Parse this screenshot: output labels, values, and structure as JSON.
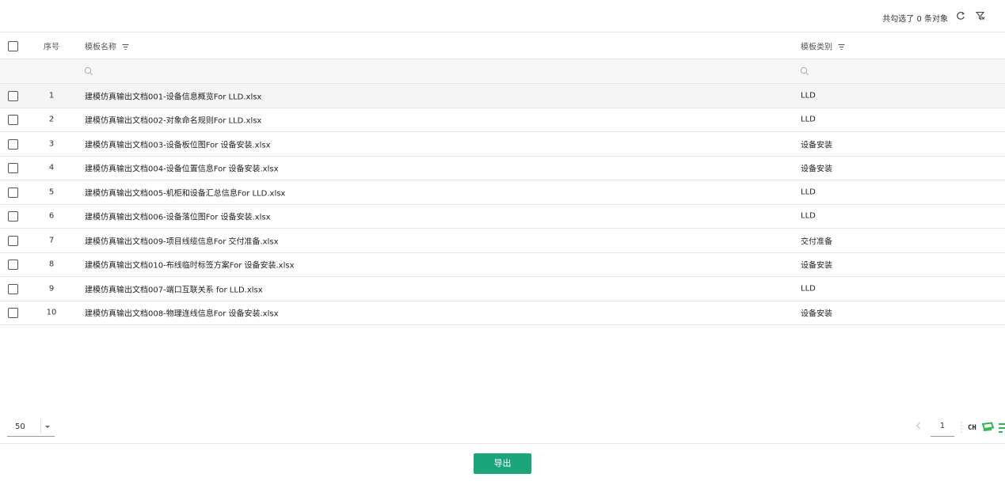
{
  "toolbar": {
    "selection_text": "共勾选了 0 条对象",
    "refresh_icon": "refresh-icon",
    "clear_filter_icon": "filter-clear-icon"
  },
  "table": {
    "columns": {
      "index": "序号",
      "name": "模板名称",
      "type": "模板类别"
    },
    "rows": [
      {
        "index": "1",
        "name": "建模仿真输出文档001-设备信息概览For LLD.xlsx",
        "type": "LLD"
      },
      {
        "index": "2",
        "name": "建模仿真输出文档002-对象命名规则For LLD.xlsx",
        "type": "LLD"
      },
      {
        "index": "3",
        "name": "建模仿真输出文档003-设备板位图For 设备安装.xlsx",
        "type": "设备安装"
      },
      {
        "index": "4",
        "name": "建模仿真输出文档004-设备位置信息For 设备安装.xlsx",
        "type": "设备安装"
      },
      {
        "index": "5",
        "name": "建模仿真输出文档005-机柜和设备汇总信息For LLD.xlsx",
        "type": "LLD"
      },
      {
        "index": "6",
        "name": "建模仿真输出文档006-设备落位图For 设备安装.xlsx",
        "type": "LLD"
      },
      {
        "index": "7",
        "name": "建模仿真输出文档009-项目线缆信息For 交付准备.xlsx",
        "type": "交付准备"
      },
      {
        "index": "8",
        "name": "建模仿真输出文档010-布线临时标签方案For 设备安装.xlsx",
        "type": "设备安装"
      },
      {
        "index": "9",
        "name": "建模仿真输出文档007-端口互联关系 for LLD.xlsx",
        "type": "LLD"
      },
      {
        "index": "10",
        "name": "建模仿真输出文档008-物理连线信息For 设备安装.xlsx",
        "type": "设备安装"
      }
    ]
  },
  "pagination": {
    "page_size": "50",
    "current_page": "1",
    "ime_label": "CH"
  },
  "footer": {
    "export_label": "导出"
  },
  "colors": {
    "accent": "#1aa67a",
    "highlight_row": "#f5f5f5"
  }
}
